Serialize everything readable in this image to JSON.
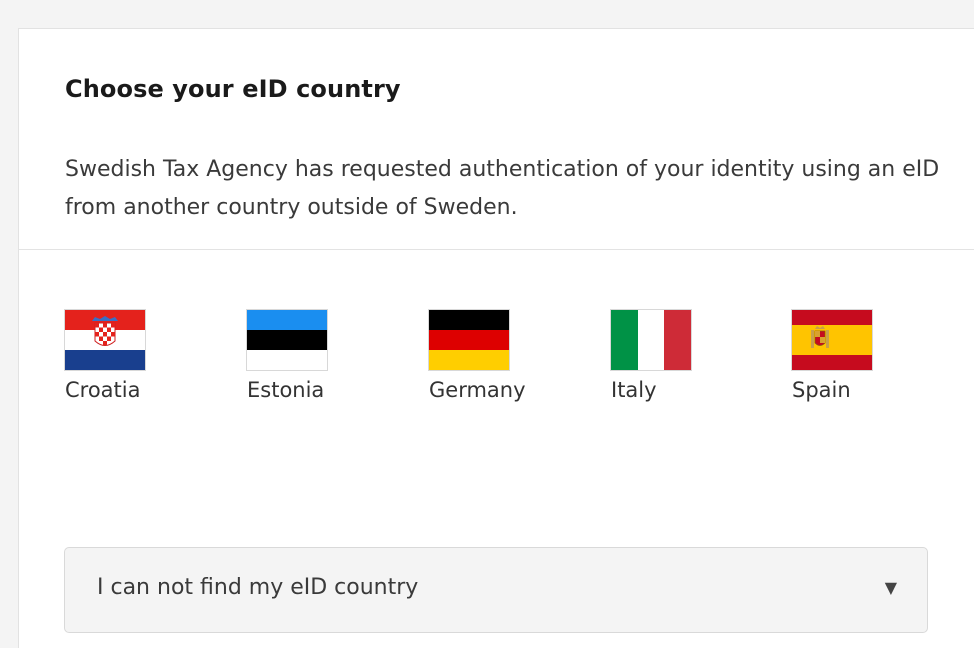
{
  "dialog": {
    "title": "Choose your eID country",
    "description": "Swedish Tax Agency has requested authentication of your identity using an eID from another country outside of Sweden."
  },
  "countries": [
    {
      "label": "Croatia",
      "flag": "croatia-flag"
    },
    {
      "label": "Estonia",
      "flag": "estonia-flag"
    },
    {
      "label": "Germany",
      "flag": "germany-flag"
    },
    {
      "label": "Italy",
      "flag": "italy-flag"
    },
    {
      "label": "Spain",
      "flag": "spain-flag"
    }
  ],
  "dropdown": {
    "label": "I can not find my eID country",
    "caret": "▼",
    "icon": "caret-down-icon"
  },
  "colors": {
    "page_background": "#f4f4f4",
    "card_background": "#ffffff",
    "dropdown_background": "#f4f4f4"
  }
}
